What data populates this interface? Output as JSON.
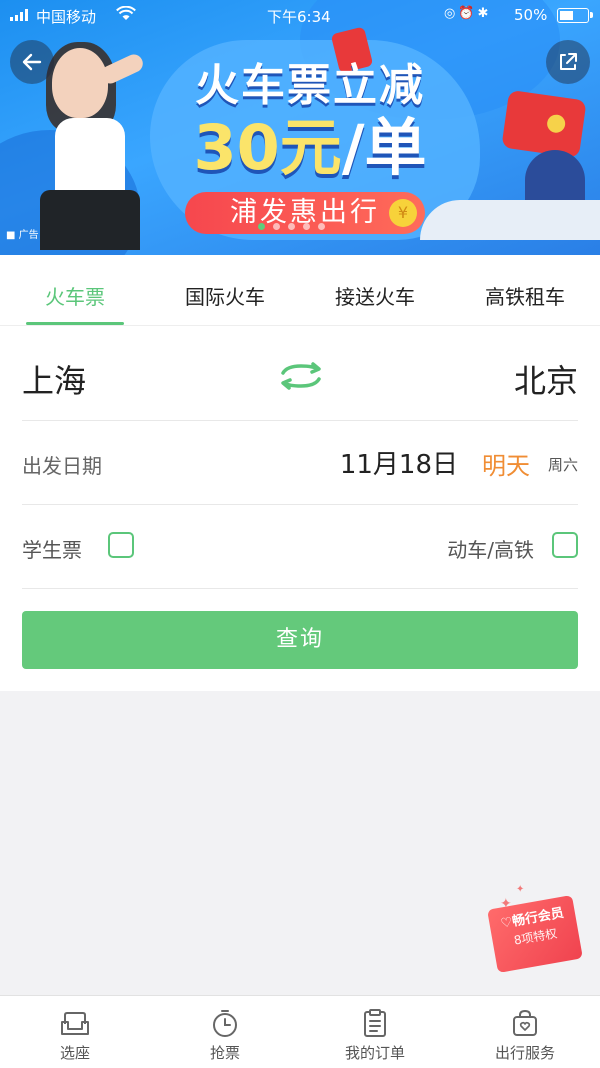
{
  "status_bar": {
    "carrier": "中国移动",
    "time": "下午6:34",
    "battery_pct": "50%",
    "battery_level": 0.5
  },
  "banner": {
    "headline": "火车票立减",
    "amount": "30元",
    "unit": "/单",
    "pill_text": "浦发惠出行",
    "coin": "¥",
    "ad_tag": "广告",
    "page_count": 5,
    "active_page": 1
  },
  "tabs": [
    {
      "label": "火车票",
      "active": true
    },
    {
      "label": "国际火车",
      "active": false
    },
    {
      "label": "接送火车",
      "active": false
    },
    {
      "label": "高铁租车",
      "active": false
    }
  ],
  "form": {
    "from_city": "上海",
    "to_city": "北京",
    "date_label": "出发日期",
    "date_value": "11月18日",
    "date_relative": "明天",
    "weekday": "周六",
    "student_label": "学生票",
    "student_checked": false,
    "highspeed_label": "动车/高铁",
    "highspeed_checked": false,
    "search_label": "查询"
  },
  "member_badge": {
    "title": "畅行会员",
    "subtitle": "8项特权"
  },
  "bottom_nav": [
    {
      "label": "选座",
      "icon": "seat-icon"
    },
    {
      "label": "抢票",
      "icon": "stopwatch-icon"
    },
    {
      "label": "我的订单",
      "icon": "clipboard-icon"
    },
    {
      "label": "出行服务",
      "icon": "bag-icon"
    }
  ],
  "colors": {
    "accent": "#5bc67a",
    "button": "#64c97b",
    "highlight": "#f08d34",
    "banner_blue": "#3aa6ff",
    "badge_red": "#f0434f"
  }
}
